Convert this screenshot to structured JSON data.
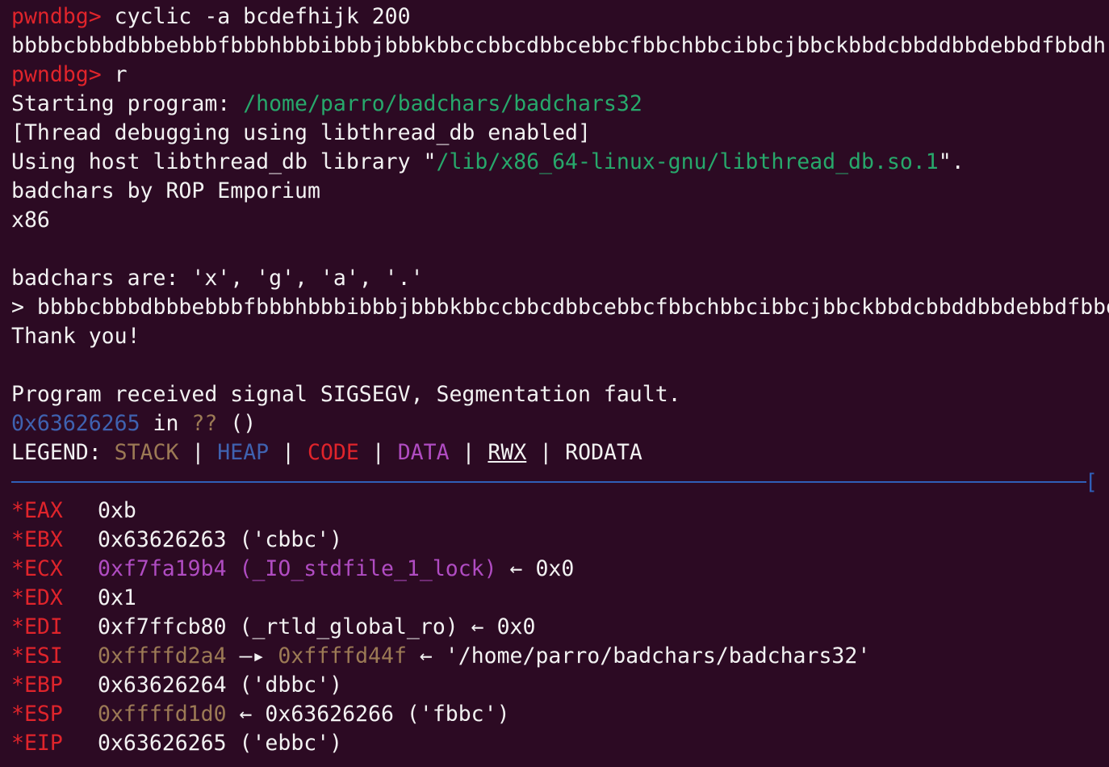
{
  "colors": {
    "background": "#2c0a23",
    "prompt": "#e0242b",
    "path": "#27a86b",
    "stack": "#9c7a55",
    "heap": "#3f62b0",
    "code": "#e0242b",
    "data": "#b04cc2",
    "divider": "#2f5fb8"
  },
  "prompt": "pwndbg>",
  "lines": {
    "cmd1": " cyclic -a bcdefhijk 200",
    "cyclic_output": "bbbbcbbbdbbbebbbfbbbhbbbibbbjbbbkbbccbbcdbbcebbcfbbchbbcibbcjbbckbbdcbbddbbdebbdfbbdh",
    "cmd2": " r",
    "starting_label": "Starting program: ",
    "starting_path": "/home/parro/badchars/badchars32",
    "thread_debug": "[Thread debugging using libthread_db enabled]",
    "using_host_prefix": "Using host libthread_db library \"",
    "using_host_path": "/lib/x86_64-linux-gnu/libthread_db.so.1",
    "using_host_suffix": "\".",
    "banner": "badchars by ROP Emporium",
    "arch": "x86",
    "badchars": "badchars are: 'x', 'g', 'a', '.'",
    "input_echo": "> bbbbcbbbdbbbebbbfbbbhbbbibbbjbbbkbbccbbcdbbcebbcfbbchbbcibbcjbbckbbdcbbddbbdebbdfbbdh",
    "thanks": "Thank you!",
    "signal": "Program received signal SIGSEGV, Segmentation fault.",
    "crash_addr": "0x63626265",
    "crash_in": " in ",
    "crash_qq": "??",
    "crash_parens": " ()"
  },
  "legend": {
    "label": "LEGEND: ",
    "stack": "STACK",
    "heap": "HEAP",
    "code": "CODE",
    "data": "DATA",
    "rwx": "RWX",
    "rodata": "RODATA",
    "sep": " | "
  },
  "divider_end": "[",
  "registers": [
    {
      "name": "*EAX",
      "value": "0xb"
    },
    {
      "name": "*EBX",
      "value": "0x63626263 ('cbbc')"
    },
    {
      "name": "*ECX",
      "addr": "0xf7fa19b4 (_IO_stdfile_1_lock)",
      "rest": " ← 0x0"
    },
    {
      "name": "*EDX",
      "value": "0x1"
    },
    {
      "name": "*EDI",
      "value": "0xf7ffcb80 (_rtld_global_ro) ← 0x0"
    },
    {
      "name": "*ESI",
      "addr": "0xffffd2a4",
      "arrow": " —▸ ",
      "addr2": "0xffffd44f",
      "rest": " ← '/home/parro/badchars/badchars32'"
    },
    {
      "name": "*EBP",
      "value": "0x63626264 ('dbbc')"
    },
    {
      "name": "*ESP",
      "addr": "0xffffd1d0",
      "rest": " ← 0x63626266 ('fbbc')"
    },
    {
      "name": "*EIP",
      "value": "0x63626265 ('ebbc')"
    }
  ]
}
